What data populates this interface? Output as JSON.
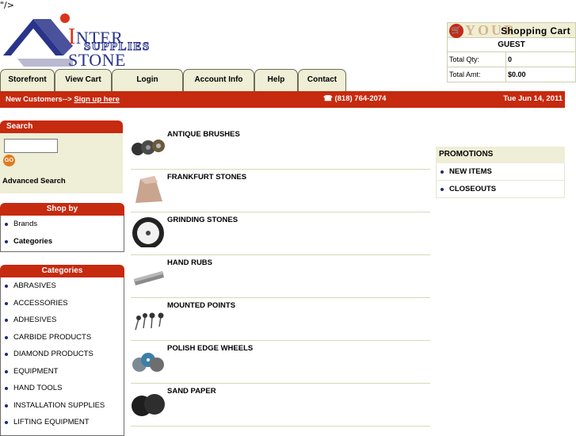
{
  "stray_text": "\"/>",
  "logo": {
    "line1": "NTER STONE",
    "line2": "SUPPLIES"
  },
  "cart": {
    "brand": "YOUR",
    "title": "Shopping Cart",
    "user": "GUEST",
    "rows": [
      {
        "label": "Total Qty:",
        "value": "0"
      },
      {
        "label": "Total Amt:",
        "value": "$0.00"
      }
    ]
  },
  "nav": {
    "tabs": [
      "Storefront",
      "View Cart",
      "Login",
      "Account Info",
      "Help",
      "Contact"
    ]
  },
  "banner": {
    "new_customers": "New Customers-->",
    "signup": "Sign up here",
    "phone": "(818) 764-2074",
    "date": "Tue Jun 14, 2011"
  },
  "search": {
    "title": "Search",
    "value": "",
    "go_label": "GO",
    "advanced": "Advanced Search"
  },
  "shop_by": {
    "title": "Shop by",
    "items": [
      "Brands",
      "Categories"
    ]
  },
  "categories": {
    "title": "Categories",
    "items": [
      "ABRASIVES",
      "ACCESSORIES",
      "ADHESIVES",
      "CARBIDE PRODUCTS",
      "DIAMOND PRODUCTS",
      "EQUIPMENT",
      "HAND TOOLS",
      "INSTALLATION SUPPLIES",
      "LIFTING EQUIPMENT"
    ]
  },
  "products": [
    {
      "name": "ANTIQUE BRUSHES",
      "icon": "brushes-image"
    },
    {
      "name": "FRANKFURT STONES",
      "icon": "stones-image"
    },
    {
      "name": "GRINDING STONES",
      "icon": "grinding-disc-image"
    },
    {
      "name": "HAND RUBS",
      "icon": "hand-rub-image"
    },
    {
      "name": "MOUNTED POINTS",
      "icon": "mounted-points-image"
    },
    {
      "name": "POLISH EDGE WHEELS",
      "icon": "wheels-image"
    },
    {
      "name": "SAND PAPER",
      "icon": "sand-paper-image"
    }
  ],
  "promotions": {
    "title": "PROMOTIONS",
    "items": [
      "NEW ITEMS",
      "CLOSEOUTS"
    ]
  },
  "colors": {
    "accent_red": "#c62a0f",
    "panel_beige": "#efeed6",
    "brand_blue": "#29348a"
  }
}
